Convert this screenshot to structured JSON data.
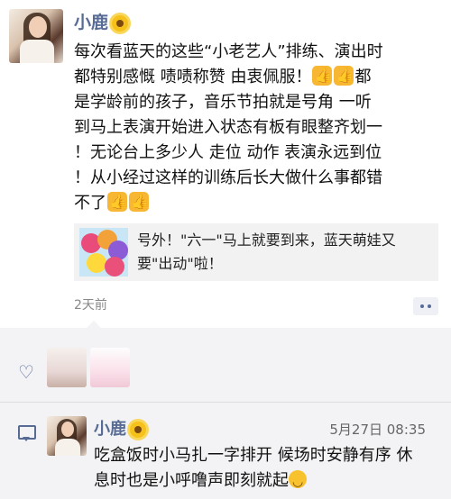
{
  "post": {
    "author": "小鹿",
    "lines": [
      "每次看蓝天的这些“小老艺人”排练、演出时",
      "都特别感慨 啧啧称赞 由衷佩服！",
      "都",
      "是学龄前的孩子，音乐节拍就是号角 一听",
      "到马上表演开始进入状态有板有眼整齐划一",
      "！无论台上多少人 走位 动作 表演永远到位",
      "！从小经过这样的训练后长大做什么事都错",
      "不了"
    ],
    "link_text": "号外！\"六一\"马上就要到来，蓝天萌娃又要\"出动\"啦！",
    "time": "2天前"
  },
  "comment": {
    "author": "小鹿",
    "date": "5月27日 08:35",
    "text": "吃盒饭时小马扎一字排开 候场时安静有序 休息时也是小呼噜声即刻就起"
  },
  "icons": {
    "heart": "heart-icon",
    "comment": "comment-icon",
    "more": "more-dots-icon"
  }
}
